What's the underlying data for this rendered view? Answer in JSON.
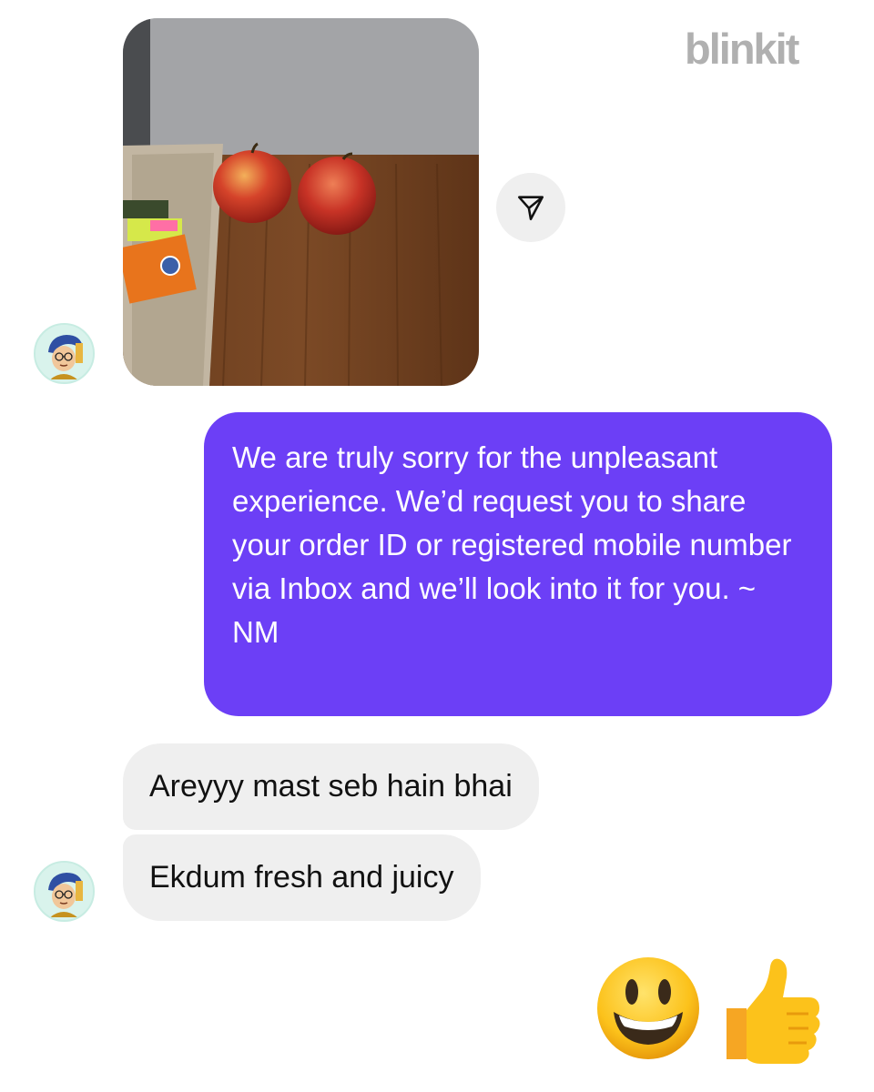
{
  "watermark": "blinkit",
  "chat": {
    "photo": {
      "description_icon": "photo-apples-on-desk"
    },
    "share_icon": "paper-plane-icon",
    "outgoing_message": "We are truly sorry for the unpleasant experience. We’d request you to share your order ID or registered mobile number via Inbox and we’ll look into it for you. ~ NM",
    "incoming_messages": [
      {
        "text": "Areyyy mast seb hain bhai"
      },
      {
        "text": "Ekdum fresh and juicy"
      }
    ],
    "reactions": [
      "smiley-emoji",
      "thumbs-up-emoji"
    ]
  },
  "colors": {
    "outgoing_bubble": "#6c3ff6",
    "incoming_bubble": "#efefef",
    "watermark": "#b0b0b0"
  }
}
